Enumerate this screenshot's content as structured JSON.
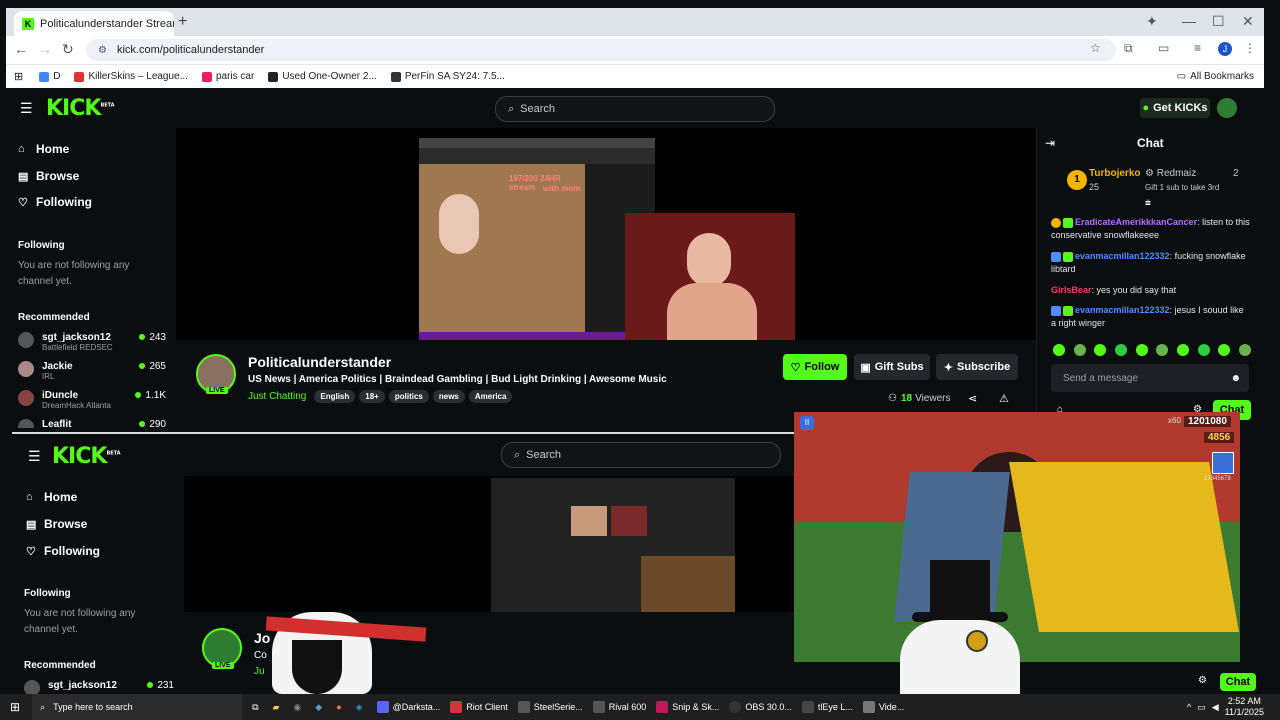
{
  "browser": {
    "tab_title": "Politicalunderstander Stream - ",
    "url": "kick.com/politicalunderstander",
    "bookmarks": [
      "D",
      "KillerSkins – League...",
      "paris car",
      "Used One-Owner 2...",
      "PerFin SA SY24: 7.5..."
    ],
    "all_bookmarks": "All Bookmarks"
  },
  "kick": {
    "search_placeholder": "Search",
    "get_kicks": "Get KICKs",
    "nav": [
      "Home",
      "Browse",
      "Following"
    ],
    "following_title": "Following",
    "following_empty": "You are not following any channel yet.",
    "recommended_title": "Recommended",
    "recommended": [
      {
        "name": "sgt_jackson12",
        "game": "Battlefield REDSEC",
        "viewers": "243"
      },
      {
        "name": "Jackie",
        "game": "IRL",
        "viewers": "265"
      },
      {
        "name": "iDuncle",
        "game": "DreamHack Atlanta",
        "viewers": "1.1K"
      },
      {
        "name": "Leaflit",
        "game": "",
        "viewers": "290"
      }
    ],
    "channel": {
      "name": "Politicalunderstander",
      "title": "US News | America Politics | Braindead Gambling | Bud Light Drinking | Awesome Music",
      "category": "Just Chatting",
      "tags": [
        "English",
        "18+",
        "politics",
        "news",
        "America"
      ],
      "live": "LIVE",
      "viewers": "18",
      "viewers_label": "Viewers"
    },
    "buttons": {
      "follow": "Follow",
      "gift": "Gift Subs",
      "subscribe": "Subscribe"
    },
    "stream_overlay": {
      "line1": "197/200 24HR stream",
      "line2": "with mom"
    },
    "chat": {
      "title": "Chat",
      "top1_name": "Turbojerko",
      "top1_count": "25",
      "top2_name": "Redmaiz",
      "top2_count": "2",
      "gift_hint": "Gift 1 sub to take 3rd",
      "messages": [
        {
          "user": "EradicateAmerikkkanCancer",
          "color": "#b36cff",
          "text": ": listen to this conservative snowflakeeee"
        },
        {
          "user": "evanmacmillan122332",
          "color": "#4f8dff",
          "text": ": fucking snowflake libtard"
        },
        {
          "user": "GirlsBear",
          "color": "#ff3b6b",
          "text": ": yes you did say that"
        },
        {
          "user": "evanmacmillan122332",
          "color": "#4f8dff",
          "text": ": jesus I souud like a right winger"
        }
      ],
      "input_placeholder": "Send a message",
      "send": "Chat"
    }
  },
  "kick2": {
    "search_placeholder": "Search",
    "nav": [
      "Home",
      "Browse",
      "Following"
    ],
    "following_title": "Following",
    "following_empty": "You are not following any channel yet.",
    "recommended_title": "Recommended",
    "rec1_name": "sgt_jackson12",
    "rec1_viewers": "231",
    "channel_partial": "Jo",
    "title_partial": "Co",
    "cat_partial": "Ju",
    "live": "LIVE",
    "chat_btn": "Chat"
  },
  "game": {
    "score": "1201080",
    "coins": "4856",
    "multiplier": "x60",
    "side": "12345678"
  },
  "taskbar": {
    "search": "Type here to search",
    "apps": [
      "@Darksta...",
      "Riot Client",
      "SteelSerie...",
      "Rival 600",
      "Snip & Sk...",
      "OBS 30.0...",
      "tlEye L...",
      "Vide..."
    ],
    "time": "2:52 AM",
    "date": "11/1/2025"
  },
  "colors": {
    "kick_green": "#53fc18",
    "bg": "#0b0e0f",
    "chrome": "#dfe3ea"
  }
}
